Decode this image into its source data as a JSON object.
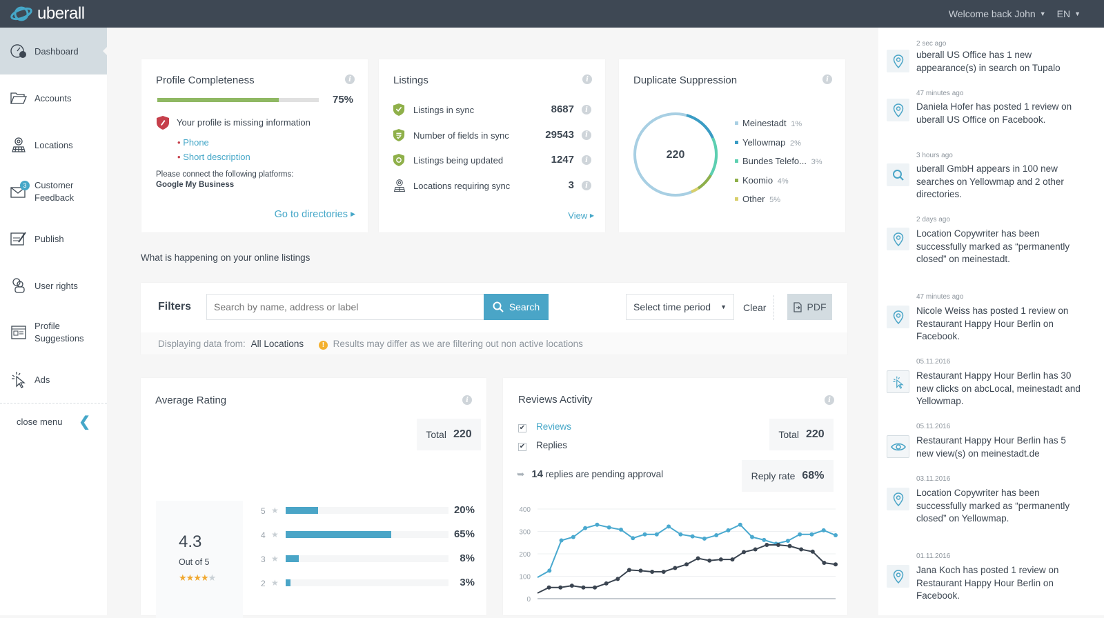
{
  "topbar": {
    "brand": "uberall",
    "welcome": "Welcome back John",
    "language": "EN"
  },
  "sidebar": {
    "items": [
      {
        "label": "Dashboard",
        "icon": "dashboard-icon",
        "active": true
      },
      {
        "label": "Accounts",
        "icon": "folder-icon"
      },
      {
        "label": "Locations",
        "icon": "location-map-icon"
      },
      {
        "label": "Customer Feedback",
        "icon": "mail-icon",
        "badge": "3"
      },
      {
        "label": "Publish",
        "icon": "publish-icon"
      },
      {
        "label": "User rights",
        "icon": "users-icon"
      },
      {
        "label": "Profile Suggestions",
        "icon": "profile-card-icon"
      },
      {
        "label": "Ads",
        "icon": "click-icon"
      }
    ],
    "close_menu": "close menu"
  },
  "profile_completeness": {
    "title": "Profile Completeness",
    "percent_label": "75%",
    "progress": 0.75,
    "warning": "Your profile is missing information",
    "missing": [
      "Phone",
      "Short description"
    ],
    "connect_text": "Please connect the following platforms:",
    "platform": "Google My Business",
    "link": "Go to directories"
  },
  "listings": {
    "title": "Listings",
    "rows": [
      {
        "label": "Listings in sync",
        "value": "8687",
        "icon": "shield-check-icon"
      },
      {
        "label": "Number of fields in sync",
        "value": "29543",
        "icon": "shield-list-icon"
      },
      {
        "label": "Listings being updated",
        "value": "1247",
        "icon": "shield-refresh-icon"
      },
      {
        "label": "Locations requiring sync",
        "value": "3",
        "icon": "location-map-icon"
      }
    ],
    "link": "View"
  },
  "duplicate_suppression": {
    "title": "Duplicate Suppression",
    "total": "220",
    "legend": [
      {
        "name": "Meinestadt",
        "pct": "1%",
        "color": "#a8cfe3"
      },
      {
        "name": "Yellowmap",
        "pct": "2%",
        "color": "#3a9cc4"
      },
      {
        "name": "Bundes Telefo...",
        "pct": "3%",
        "color": "#5ccfb0"
      },
      {
        "name": "Koomio",
        "pct": "4%",
        "color": "#8fb04a"
      },
      {
        "name": "Other",
        "pct": "5%",
        "color": "#d8cf6a"
      }
    ]
  },
  "section_title": "What is happening on your online listings",
  "filters": {
    "label": "Filters",
    "search_placeholder": "Search by name, address or label",
    "search_button": "Search",
    "time_period": "Select time period",
    "clear": "Clear",
    "pdf": "PDF",
    "displaying_label": "Displaying data from:",
    "displaying_value": "All Locations",
    "notice": "Results may differ as we are filtering out non active locations"
  },
  "average_rating": {
    "title": "Average Rating",
    "total_label": "Total",
    "total_value": "220",
    "score": "4.3",
    "out_of": "Out of 5",
    "stars": 4,
    "rows": [
      {
        "star": "5",
        "pct": 20,
        "label": "20%"
      },
      {
        "star": "4",
        "pct": 65,
        "label": "65%"
      },
      {
        "star": "3",
        "pct": 8,
        "label": "8%"
      },
      {
        "star": "2",
        "pct": 3,
        "label": "3%"
      }
    ]
  },
  "reviews_activity": {
    "title": "Reviews Activity",
    "checkbox_reviews": "Reviews",
    "checkbox_replies": "Replies",
    "pending_count": "14",
    "pending_text": "replies are pending approval",
    "total_label": "Total",
    "total_value": "220",
    "reply_rate_label": "Reply rate",
    "reply_rate_value": "68%"
  },
  "chart_data": {
    "type": "line",
    "title": "Reviews Activity",
    "xlabel": "",
    "ylabel": "",
    "ylim": [
      0,
      400
    ],
    "yticks": [
      "400",
      "300",
      "200",
      "100",
      "0"
    ],
    "grid": true,
    "series": [
      {
        "name": "Reviews",
        "color": "#4aa9cf",
        "values": [
          95,
          125,
          260,
          275,
          315,
          330,
          318,
          308,
          270,
          287,
          287,
          322,
          287,
          278,
          268,
          283,
          305,
          330,
          275,
          262,
          245,
          258,
          287,
          287,
          305,
          283
        ]
      },
      {
        "name": "Replies",
        "color": "#3a4450",
        "values": [
          25,
          50,
          50,
          58,
          50,
          50,
          68,
          88,
          128,
          125,
          120,
          120,
          137,
          153,
          180,
          170,
          175,
          175,
          208,
          220,
          240,
          240,
          235,
          220,
          210,
          160,
          153
        ]
      }
    ]
  },
  "feed": [
    {
      "time": "2 sec ago",
      "text": "uberall US Office has 1 new appearance(s) in search on Tupalo",
      "icon": "pin-icon"
    },
    {
      "time": "47 minutes ago",
      "text": "Daniela Hofer has posted 1 review on uberall US Office on Facebook.",
      "icon": "pin-icon"
    },
    {
      "time": "3 hours ago",
      "text": "uberall GmbH appears in 100 new searches on Yellowmap and 2 other directories.",
      "icon": "search-icon"
    },
    {
      "time": "2 days ago",
      "text": "Location Copywriter has been successfully marked as “permanently closed” on meinestadt.",
      "icon": "pin-icon"
    },
    {
      "time": "47 minutes ago",
      "text": "Nicole Weiss has posted 1 review on Restaurant Happy Hour Berlin on Facebook.",
      "icon": "pin-icon"
    },
    {
      "time": "05.11.2016",
      "text": "Restaurant Happy Hour Berlin has 30 new clicks on abcLocal, meinestadt and Yellowmap.",
      "icon": "click-icon"
    },
    {
      "time": "05.11.2016",
      "text": "Restaurant Happy Hour Berlin has 5 new view(s) on meinestadt.de",
      "icon": "eye-icon"
    },
    {
      "time": "03.11.2016",
      "text": "Location Copywriter has been successfully marked as “permanently closed” on Yellowmap.",
      "icon": "pin-icon"
    },
    {
      "time": "01.11.2016",
      "text": "Jana Koch has posted 1 review on Restaurant Happy Hour Berlin on Facebook.",
      "icon": "pin-icon"
    }
  ]
}
